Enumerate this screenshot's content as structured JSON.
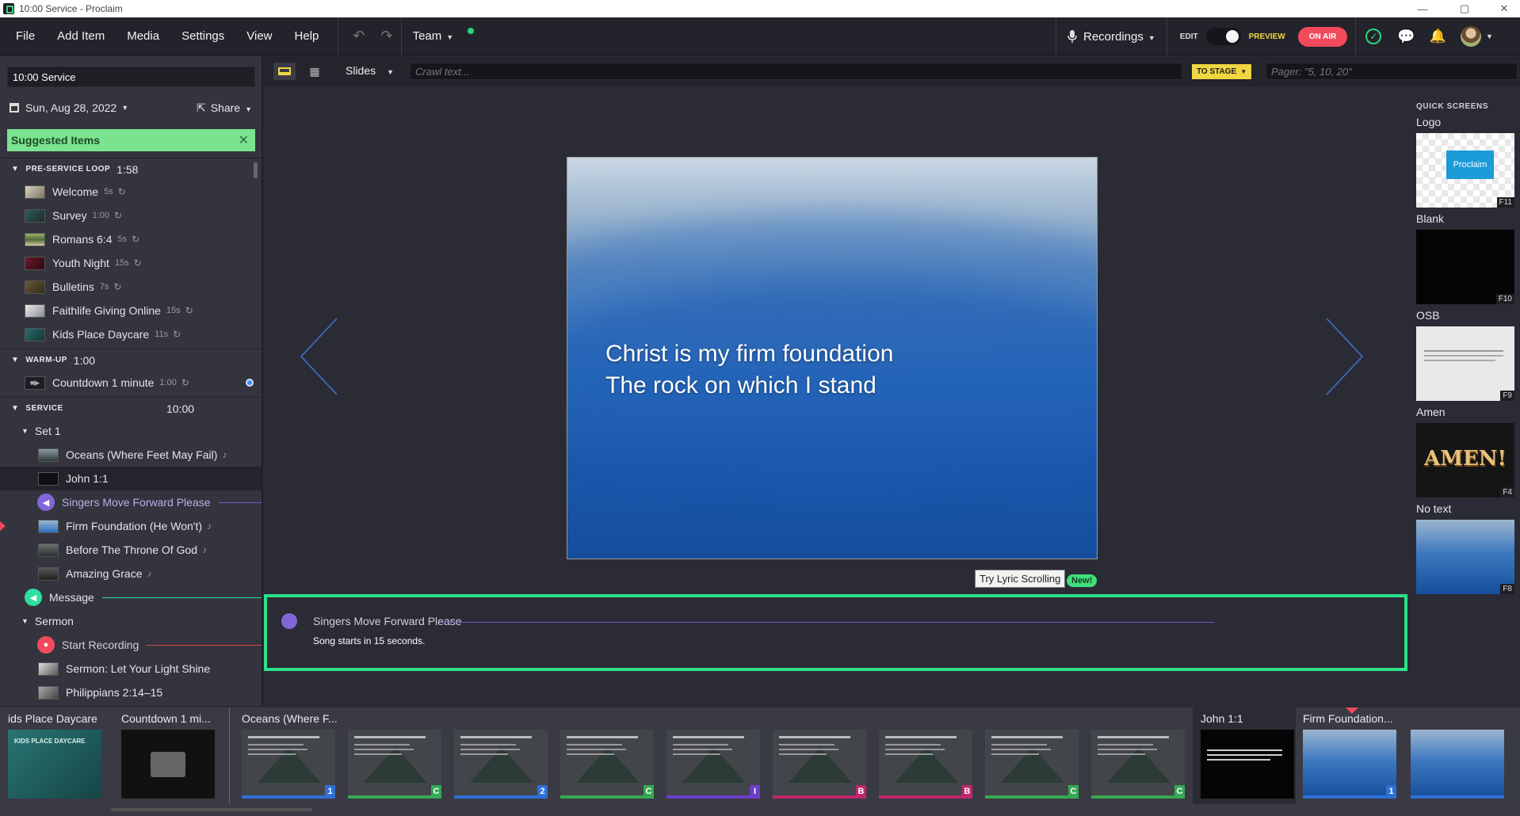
{
  "window": {
    "title": "10:00 Service - Proclaim",
    "controls": [
      "—",
      "▢",
      "✕"
    ]
  },
  "menu": {
    "items": [
      "File",
      "Add Item",
      "Media",
      "Settings",
      "View",
      "Help"
    ],
    "team": "Team",
    "recordings": "Recordings",
    "edit": "EDIT",
    "preview": "PREVIEW",
    "onair": "ON AIR"
  },
  "toolbar": {
    "slides": "Slides",
    "crawl_placeholder": "Crawl text...",
    "to_stage": "TO STAGE",
    "pager_placeholder": "Pager: \"5, 10, 20\""
  },
  "left": {
    "service_name": "10:00 Service",
    "date": "Sun, Aug 28, 2022",
    "share": "Share",
    "suggested": "Suggested Items"
  },
  "sections": [
    {
      "name": "PRE-SERVICE LOOP",
      "dur": "1:58"
    },
    {
      "name": "WARM-UP",
      "dur": "1:00"
    },
    {
      "name": "SERVICE",
      "dur": "10:00"
    }
  ],
  "preloop": [
    {
      "label": "Welcome",
      "time": "5s"
    },
    {
      "label": "Survey",
      "time": "1:00"
    },
    {
      "label": "Romans 6:4",
      "time": "5s"
    },
    {
      "label": "Youth Night",
      "time": "15s"
    },
    {
      "label": "Bulletins",
      "time": "7s"
    },
    {
      "label": "Faithlife Giving Online",
      "time": "15s"
    },
    {
      "label": "Kids Place Daycare",
      "time": "11s"
    }
  ],
  "warmup": [
    {
      "label": "Countdown 1 minute",
      "time": "1:00"
    }
  ],
  "service": {
    "set1": "Set 1",
    "set1_items": [
      "Oceans (Where Feet May Fail)",
      "John 1:1",
      "Singers Move Forward Please",
      "Firm Foundation (He Won't)",
      "Before The Throne Of God",
      "Amazing Grace"
    ],
    "message": "Message",
    "sermon": "Sermon",
    "sermon_items": [
      "Start Recording",
      "Sermon: Let Your Light Shine",
      "Philippians 2:14–15"
    ]
  },
  "slide": {
    "line1": "Christ is my firm foundation",
    "line2": "The rock on which I stand"
  },
  "try_lyric": "Try Lyric Scrolling",
  "new_badge": "New!",
  "message_box": {
    "title": "Singers Move Forward Please",
    "sub": "Song starts in 15 seconds."
  },
  "quick": {
    "header": "QUICK SCREENS",
    "items": [
      {
        "label": "Logo",
        "key": "F11",
        "logo_text": "Proclaim"
      },
      {
        "label": "Blank",
        "key": "F10"
      },
      {
        "label": "OSB",
        "key": "F9"
      },
      {
        "label": "Amen",
        "key": "F4",
        "text": "AMEN!"
      },
      {
        "label": "No text",
        "key": "F8"
      }
    ]
  },
  "bottom": {
    "groups": [
      "ids Place Daycare",
      "Countdown 1 mi...",
      "Oceans (Where F...",
      "John 1:1",
      "Firm Foundation..."
    ],
    "kids_text": "KIDS PLACE DAYCARE",
    "oceans_labels": [
      "1",
      "C",
      "2",
      "C",
      "I",
      "B",
      "B",
      "C",
      "C"
    ],
    "firm_labels": [
      "1",
      ""
    ],
    "colors": {
      "blue": "#2f6fd6",
      "green": "#35a853",
      "purple": "#6b3fc8",
      "magenta": "#c0266b"
    }
  }
}
